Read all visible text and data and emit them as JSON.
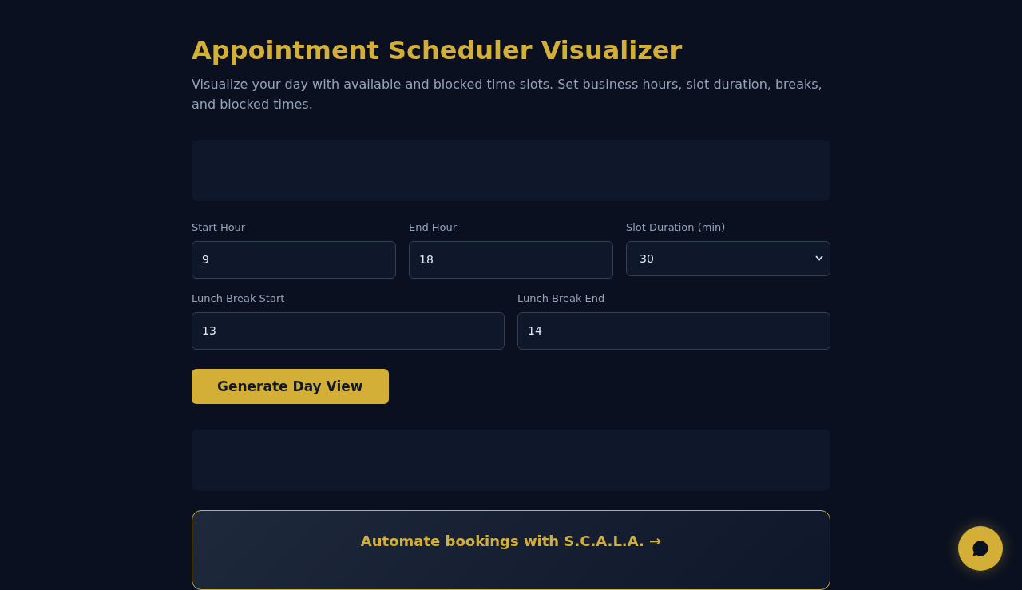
{
  "header": {
    "title": "Appointment Scheduler Visualizer",
    "subtitle": "Visualize your day with available and blocked time slots. Set business hours, slot duration, breaks, and blocked times."
  },
  "settings": {
    "rows": [
      {
        "fields": [
          {
            "kind": "number",
            "label": "Start Hour",
            "value": "9"
          },
          {
            "kind": "number",
            "label": "End Hour",
            "value": "18"
          },
          {
            "kind": "select",
            "label": "Slot Duration (min)",
            "value": "30"
          }
        ]
      },
      {
        "fields": [
          {
            "kind": "number",
            "label": "Lunch Break Start",
            "value": "13"
          },
          {
            "kind": "number",
            "label": "Lunch Break End",
            "value": "14"
          }
        ]
      }
    ],
    "button": "Generate Day View"
  },
  "promo": {
    "text": "Automate bookings with S.C.A.L.A. →"
  }
}
